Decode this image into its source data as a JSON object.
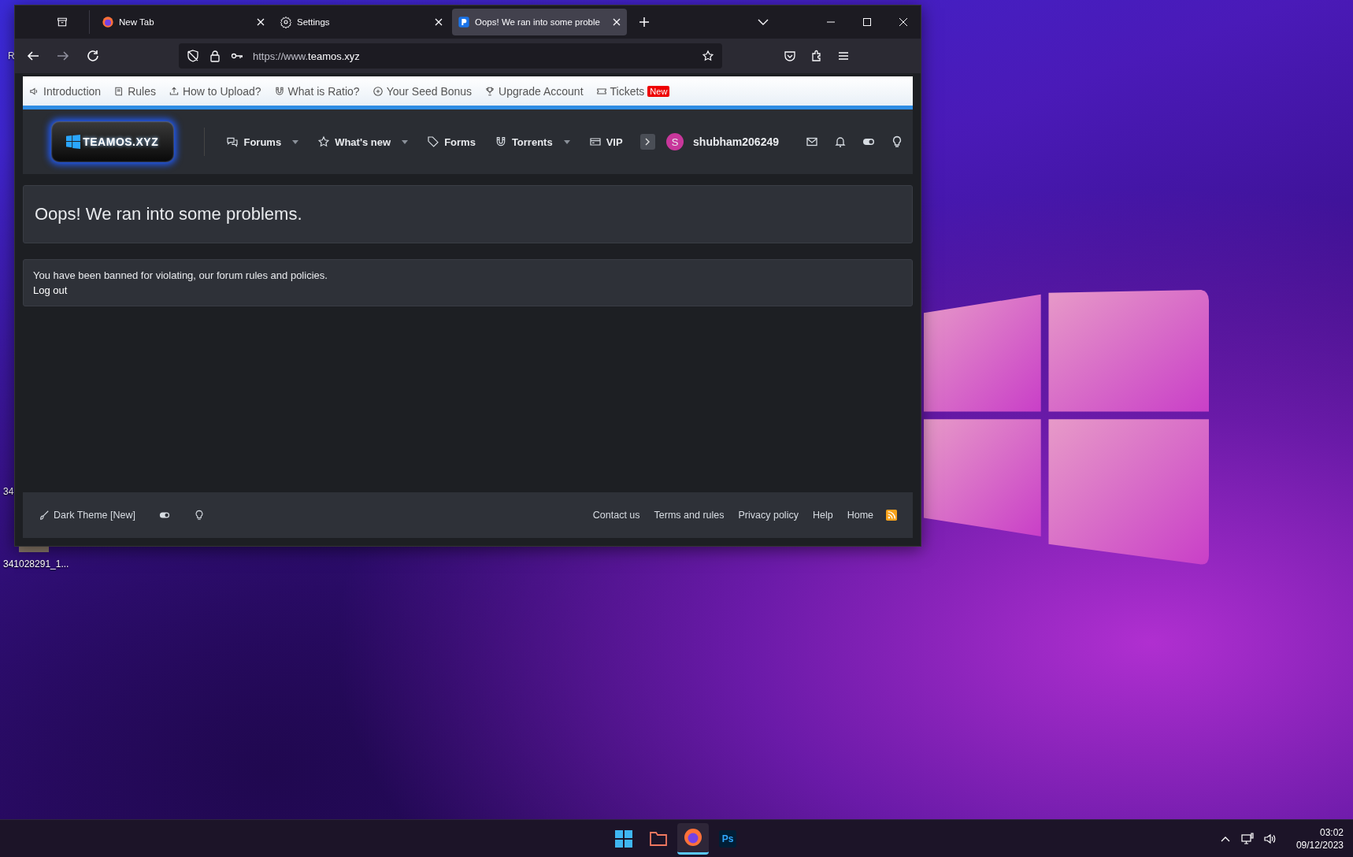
{
  "desktop": {
    "icons": [
      {
        "label": "R"
      },
      {
        "label": "34"
      },
      {
        "label": "341028291_1..."
      }
    ]
  },
  "browser": {
    "tabs": [
      {
        "title": "New Tab",
        "selected": false
      },
      {
        "title": "Settings",
        "selected": false
      },
      {
        "title": "Oops! We ran into some proble",
        "selected": true
      }
    ],
    "url_prefix": "https://www.",
    "url_host": "teamos.xyz"
  },
  "site": {
    "top_links": [
      {
        "label": "Introduction"
      },
      {
        "label": "Rules"
      },
      {
        "label": "How to Upload?"
      },
      {
        "label": "What is Ratio?"
      },
      {
        "label": "Your Seed Bonus"
      },
      {
        "label": "Upgrade Account"
      },
      {
        "label": "Tickets",
        "badge": "New"
      }
    ],
    "logo_text": "TEAMOS.XYZ",
    "nav": [
      {
        "label": "Forums",
        "dropdown": true
      },
      {
        "label": "What's new",
        "dropdown": true
      },
      {
        "label": "Forms",
        "dropdown": false
      },
      {
        "label": "Torrents",
        "dropdown": true
      },
      {
        "label": "VIP",
        "dropdown": false
      }
    ],
    "user": {
      "avatar_letter": "S",
      "name": "shubham206249"
    }
  },
  "error": {
    "title": "Oops! We ran into some problems.",
    "message": "You have been banned for violating, our forum rules and policies.",
    "link": "Log out"
  },
  "footer": {
    "theme_label": "Dark Theme [New]",
    "links": [
      "Contact us",
      "Terms and rules",
      "Privacy policy",
      "Help",
      "Home"
    ]
  },
  "taskbar": {
    "apps": [
      {
        "kind": "start",
        "selected": false
      },
      {
        "kind": "files",
        "selected": false
      },
      {
        "kind": "firefox",
        "selected": true
      },
      {
        "kind": "photoshop",
        "label": "Ps",
        "selected": false
      }
    ],
    "time": "03:02",
    "date": "09/12/2023"
  }
}
